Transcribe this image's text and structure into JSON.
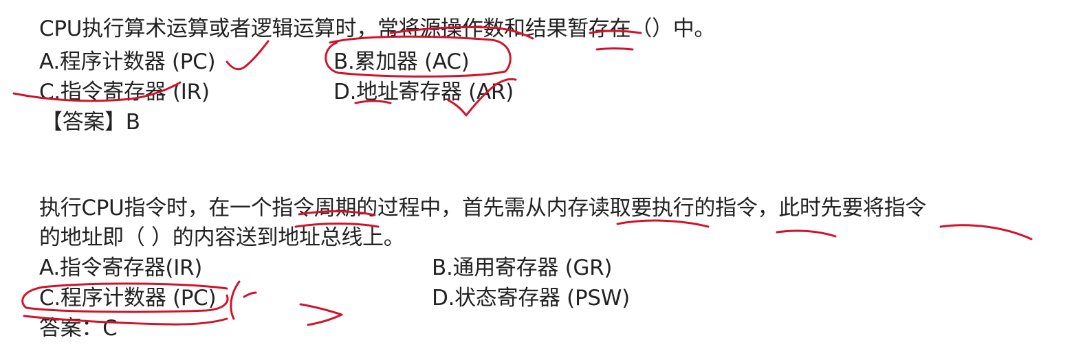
{
  "colors": {
    "text": "#222222",
    "ink": "#d3122a",
    "background": "#ffffff"
  },
  "questions": [
    {
      "stem": [
        "CPU执行算术运算或者逻辑运算时，常将源操作数和结果暂存在（）中。"
      ],
      "options": [
        "A.程序计数器 (PC)",
        "B.累加器 (AC)",
        "C.指令寄存器 (IR)",
        "D.地址寄存器 (AR)"
      ],
      "answer": "【答案】B"
    },
    {
      "stem": [
        "执行CPU指令时，在一个指令周期的过程中，首先需从内存读取要执行的指令，此时先要将指令",
        "的地址即（ ）的内容送到地址总线上。"
      ],
      "options": [
        "A.指令寄存器(IR)",
        "B.通用寄存器 (GR)",
        "C.程序计数器 (PC)",
        "D.状态寄存器 (PSW)"
      ],
      "answer": "答案：C"
    }
  ]
}
